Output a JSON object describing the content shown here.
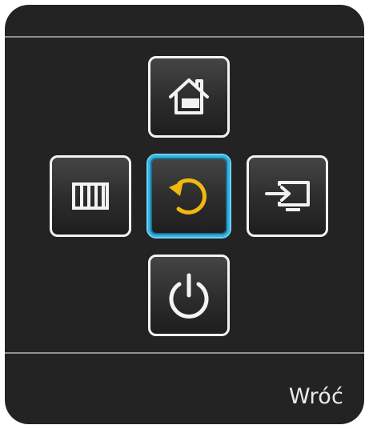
{
  "controller": {
    "buttons": [
      {
        "id": "home",
        "icon": "home-icon"
      },
      {
        "id": "menu",
        "icon": "menu-icon"
      },
      {
        "id": "return",
        "icon": "return-icon",
        "selected": true
      },
      {
        "id": "source",
        "icon": "source-icon"
      },
      {
        "id": "power",
        "icon": "power-icon"
      }
    ],
    "selected_label": "Wróć"
  },
  "colors": {
    "panel_background": "#232323",
    "button_border": "#f3f3f3",
    "selected_border": "#2fb3e3",
    "return_icon": "#f1b90f",
    "label_text": "#eaeaea"
  }
}
